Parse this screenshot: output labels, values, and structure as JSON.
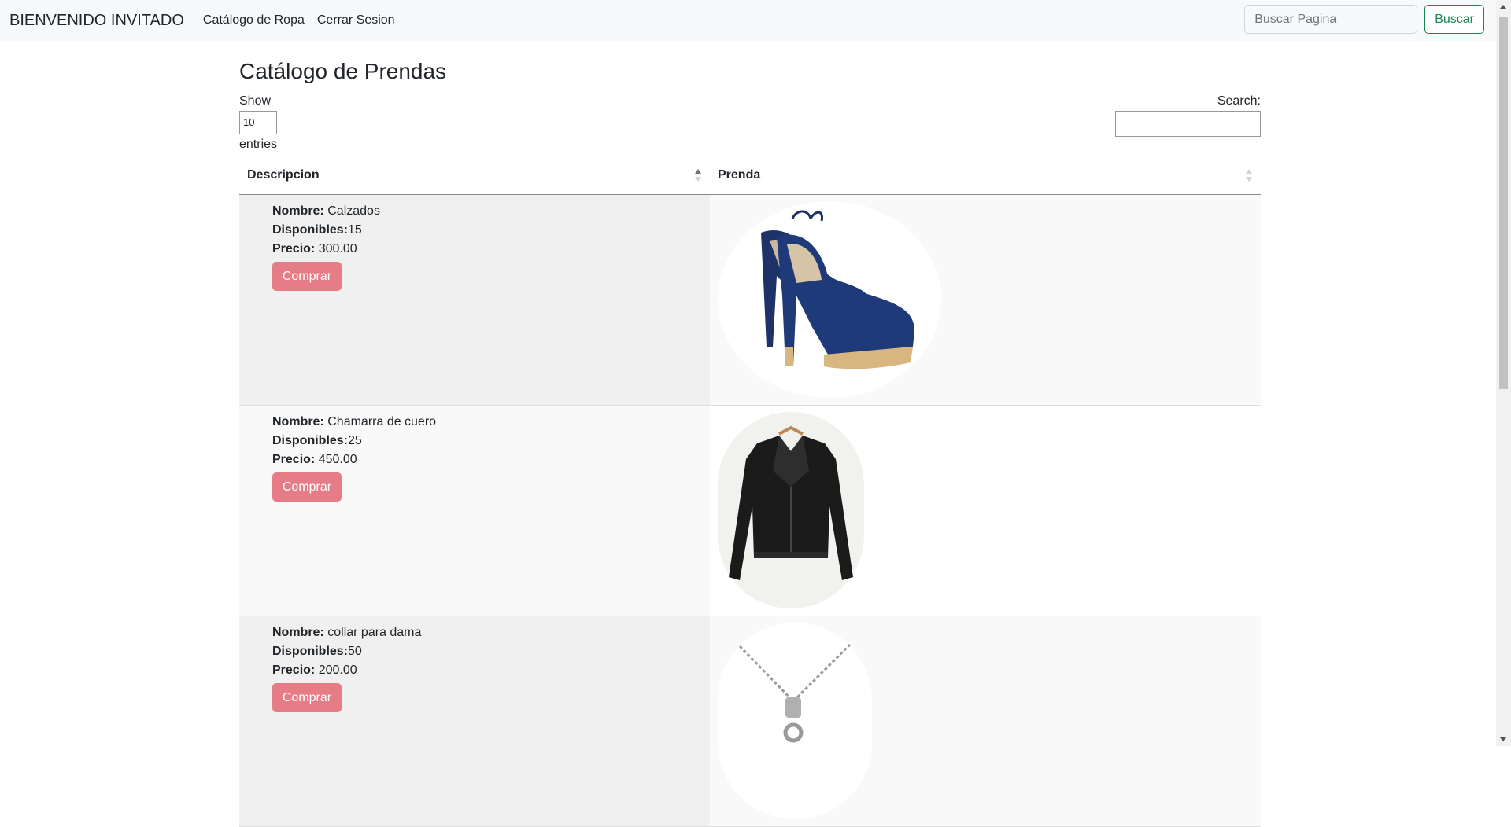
{
  "navbar": {
    "brand": "BIENVENIDO INVITADO",
    "links": [
      "Catálogo de Ropa",
      "Cerrar Sesion"
    ],
    "search_placeholder": "Buscar Pagina",
    "search_button": "Buscar"
  },
  "page": {
    "title": "Catálogo de Prendas",
    "show_label": "Show",
    "entries_value": "10",
    "entries_label": "entries",
    "search_label": "Search:"
  },
  "table": {
    "headers": [
      "Descripcion",
      "Prenda"
    ],
    "labels": {
      "name": "Nombre:",
      "available": "Disponibles:",
      "price": "Precio:"
    },
    "rows": [
      {
        "name": "Calzados",
        "available": "15",
        "price": "300.00",
        "button": "Comprar",
        "image": "blue-high-heel-shoes"
      },
      {
        "name": "Chamarra de cuero",
        "available": "25",
        "price": "450.00",
        "button": "Comprar",
        "image": "black-leather-jacket"
      },
      {
        "name": "collar para dama",
        "available": "50",
        "price": "200.00",
        "button": "Comprar",
        "image": "silver-necklace"
      }
    ]
  },
  "colors": {
    "navbar_bg": "#f8f9fa",
    "buy_button": "#e67c86",
    "search_button": "#198754"
  }
}
